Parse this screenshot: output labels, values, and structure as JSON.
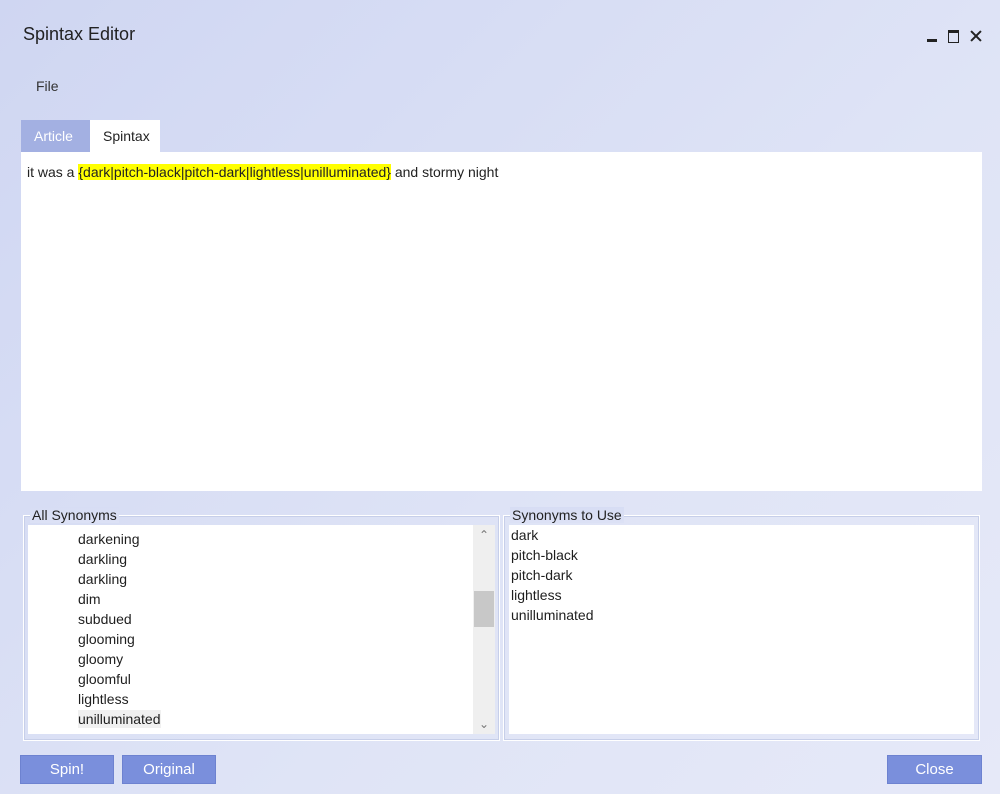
{
  "window": {
    "title": "Spintax Editor"
  },
  "menu": {
    "file_label": "File"
  },
  "tabs": [
    {
      "label": "Article",
      "active": false
    },
    {
      "label": "Spintax",
      "active": true
    }
  ],
  "editor": {
    "text_before": "it was a ",
    "spintax": "{dark|pitch-black|pitch-dark|lightless|unilluminated}",
    "text_after": " and stormy night",
    "highlight_color": "#ffff00"
  },
  "all_synonyms": {
    "label": "All Synonyms",
    "items": [
      "darkening",
      "darkling",
      "darkling",
      "dim",
      "subdued",
      "glooming",
      "gloomy",
      "gloomful",
      "lightless",
      "unilluminated"
    ],
    "selected_index": 9
  },
  "synonyms_to_use": {
    "label": "Synonyms to Use",
    "items": [
      "dark",
      "pitch-black",
      "pitch-dark",
      "lightless",
      "unilluminated"
    ]
  },
  "buttons": {
    "spin_label": "Spin!",
    "original_label": "Original",
    "close_label": "Close"
  },
  "colors": {
    "accent": "#7a8fdc",
    "inactive_tab": "#a3b0e2"
  }
}
